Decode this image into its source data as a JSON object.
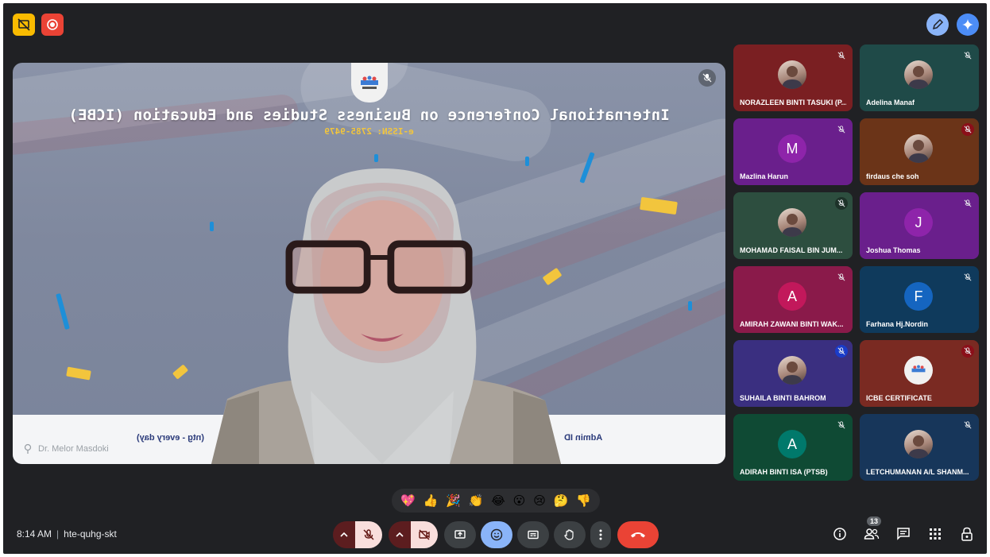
{
  "top_bar": {
    "left_icons": [
      "slides-off-icon",
      "record-icon"
    ],
    "right_icons": [
      "pencil-icon",
      "gemini-icon"
    ]
  },
  "stage": {
    "title": "International Conference on Business Studies and Education (ICBE)",
    "issn": "e-ISSN: 2785-9479",
    "band_left": "Admin ID",
    "band_right": "(ntg - every day)",
    "speaker_name": "Dr. Melor Masdoki"
  },
  "participants": [
    {
      "name": "NORAZLEEN BINTI TASUKI (P...",
      "initial": "",
      "color": "#7a1f22",
      "mic": "plain",
      "avatar_type": "photo"
    },
    {
      "name": "Adelina Manaf",
      "initial": "",
      "color": "#1f4a48",
      "mic": "plain",
      "avatar_type": "photo"
    },
    {
      "name": "Mazlina Harun",
      "initial": "M",
      "color": "#6a1f8c",
      "mic": "plain",
      "avatar_type": "letter"
    },
    {
      "name": "firdaus che soh",
      "initial": "",
      "color": "#6b3418",
      "mic": "red",
      "avatar_type": "photo"
    },
    {
      "name": "MOHAMAD FAISAL BIN JUM...",
      "initial": "",
      "color": "#2d4e3f",
      "mic": "dark",
      "avatar_type": "photo"
    },
    {
      "name": "Joshua Thomas",
      "initial": "J",
      "color": "#6a1f8c",
      "mic": "plain",
      "avatar_type": "letter"
    },
    {
      "name": "AMIRAH ZAWANI BINTI WAK...",
      "initial": "A",
      "color": "#8a1a4a",
      "mic": "plain",
      "avatar_type": "letter"
    },
    {
      "name": "Farhana Hj.Nordin",
      "initial": "F",
      "color": "#0f3a5c",
      "mic": "plain",
      "avatar_type": "letter"
    },
    {
      "name": "SUHAILA BINTI BAHROM",
      "initial": "",
      "color": "#3a2f80",
      "mic": "blue",
      "avatar_type": "photo"
    },
    {
      "name": "ICBE CERTIFICATE",
      "initial": "",
      "color": "#7a2a22",
      "mic": "red",
      "avatar_type": "logo"
    },
    {
      "name": "ADIRAH BINTI ISA (PTSB)",
      "initial": "A",
      "color": "#0f4a34",
      "mic": "plain",
      "avatar_type": "letter"
    },
    {
      "name": "LETCHUMANAN A/L SHANM...",
      "initial": "",
      "color": "#17365a",
      "mic": "plain",
      "avatar_type": "photo"
    }
  ],
  "reactions": [
    "💖",
    "👍",
    "🎉",
    "👏",
    "😂",
    "😮",
    "😢",
    "🤔",
    "👎"
  ],
  "meeting": {
    "time": "8:14 AM",
    "separator": "|",
    "code": "hte-quhg-skt"
  },
  "controls": {
    "participants_count": "13"
  },
  "colors": {
    "background": "#202124",
    "accent_blue": "#8ab4f8",
    "end_call": "#ea4335"
  }
}
